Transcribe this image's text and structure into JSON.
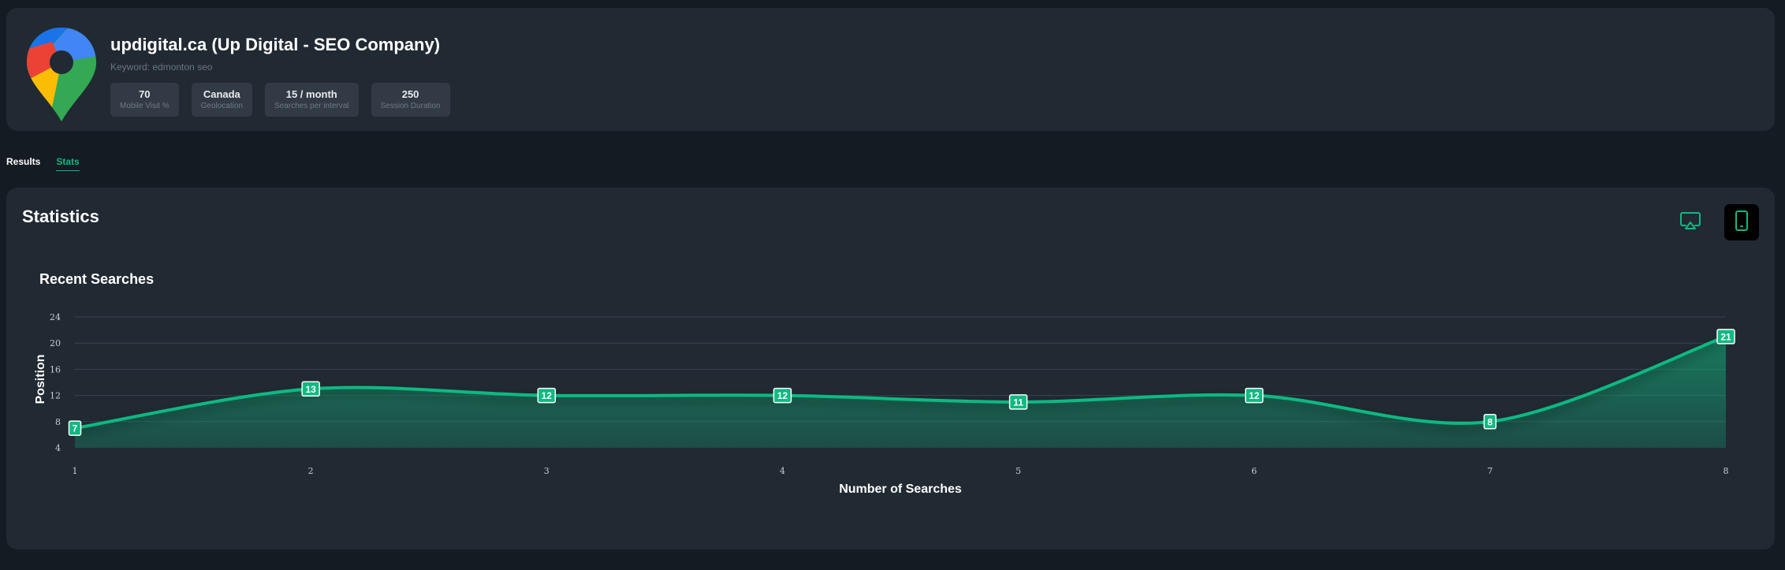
{
  "header": {
    "title": "updigital.ca (Up Digital - SEO Company)",
    "keyword": "Keyword: edmonton seo",
    "logo_icon": "google-maps-pin-icon",
    "stats": [
      {
        "value": "70",
        "label": "Mobile Visit %"
      },
      {
        "value": "Canada",
        "label": "Geolocation"
      },
      {
        "value": "15 / month",
        "label": "Searches per interval"
      },
      {
        "value": "250",
        "label": "Session Duration"
      }
    ]
  },
  "tabs": [
    {
      "label": "Results",
      "active": false
    },
    {
      "label": "Stats",
      "active": true
    }
  ],
  "statistics": {
    "title": "Statistics",
    "desktop_icon": "desktop-cast-icon",
    "mobile_icon": "mobile-phone-icon",
    "active_device": "mobile"
  },
  "colors": {
    "accent": "#10b981",
    "background": "#151b22",
    "card": "#212933"
  },
  "chart_data": {
    "type": "area",
    "title": "Recent Searches",
    "xlabel": "Number of Searches",
    "ylabel": "Position",
    "x": [
      1,
      2,
      3,
      4,
      5,
      6,
      7,
      8
    ],
    "values": [
      7,
      13,
      12,
      12,
      11,
      12,
      8,
      21
    ],
    "ylim": [
      4,
      24
    ],
    "yticks": [
      4,
      8,
      12,
      16,
      20,
      24
    ],
    "xlim": [
      1,
      8
    ],
    "grid": true,
    "data_labels": true,
    "color": "#10b981"
  }
}
